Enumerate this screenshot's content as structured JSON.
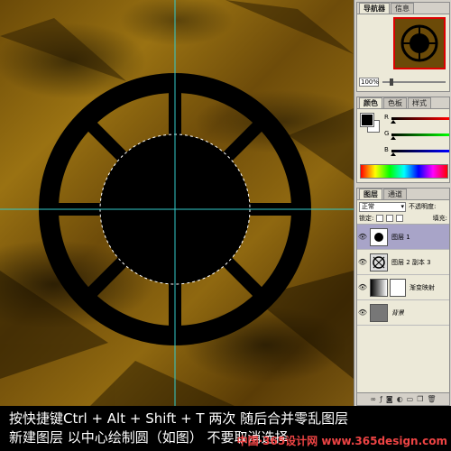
{
  "navigator": {
    "tabs": [
      {
        "label": "导航器",
        "active": true
      },
      {
        "label": "信息",
        "active": false
      }
    ],
    "zoom": "100%"
  },
  "color_panel": {
    "tabs": [
      {
        "label": "颜色",
        "active": true
      },
      {
        "label": "色板",
        "active": false
      },
      {
        "label": "样式",
        "active": false
      }
    ],
    "channels": [
      "R",
      "G",
      "B"
    ],
    "foreground_color": "#000000",
    "background_color": "#ffffff"
  },
  "layers_panel": {
    "tabs": [
      {
        "label": "图层",
        "active": true
      },
      {
        "label": "通道",
        "active": false
      }
    ],
    "blend_mode": "正常",
    "opacity_label": "不透明度:",
    "lock_label": "锁定:",
    "fill_label": "填充:",
    "layers": [
      {
        "name": "图层 1",
        "selected": true
      },
      {
        "name": "图层 2 副本 3",
        "selected": false
      },
      {
        "name": "渐变映射",
        "selected": false
      },
      {
        "name": "背景",
        "selected": false
      }
    ]
  },
  "caption": {
    "line1": "按快捷键Ctrl + Alt + Shift + T 两次 随后合并零乱图层",
    "line2": "新建图层 以中心绘制圆（如图）  不要取消选择"
  },
  "watermark": "中国·365设计网 www.365design.com",
  "colors": {
    "canvas_base": "#7a5710",
    "guide": "#33cccc",
    "shape": "#000000",
    "selected_layer": "#a8a4c8"
  }
}
